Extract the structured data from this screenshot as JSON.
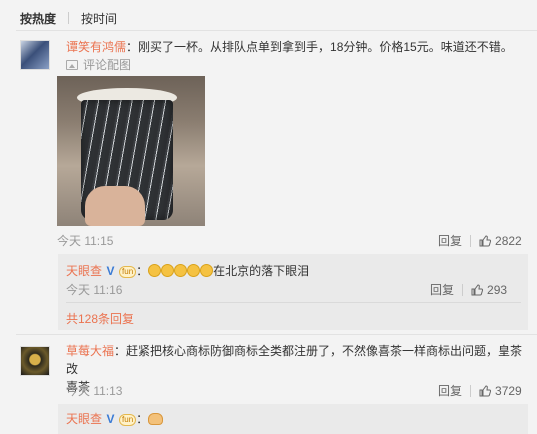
{
  "tabs": {
    "hot": "按热度",
    "time": "按时间"
  },
  "comment1": {
    "author": "谭笑有鸿儒",
    "text": "：刚买了一杯。从排队点单到拿到手，18分钟。价格15元。味道还不错。",
    "image_link": "评论配图",
    "time": "今天 11:15",
    "reply_label": "回复",
    "like_count": "2822"
  },
  "reply1": {
    "author": "天眼查",
    "badge_tag": "fun",
    "text": "在北京的落下眼泪",
    "time": "今天 11:16",
    "reply_label": "回复",
    "like_count": "293"
  },
  "more_replies": "共128条回复",
  "comment2": {
    "author": "草莓大福",
    "text_line1": "：赶紧把核心商标防御商标全类都注册了，不然像喜茶一样商标出问题，皇茶改",
    "text_line2": "喜茶",
    "time": "今天 11:13",
    "reply_label": "回复",
    "like_count": "3729"
  },
  "reply2": {
    "author": "天眼查",
    "badge_tag": "fun"
  },
  "icons": {
    "thumb": "thumbs-up-icon",
    "image": "image-icon",
    "verified": "verified-v-icon"
  },
  "colors": {
    "name": "#eb7350",
    "verified": "#3a7bd5",
    "background": "#f3f3f3",
    "reply_bg": "#eaeaea"
  }
}
